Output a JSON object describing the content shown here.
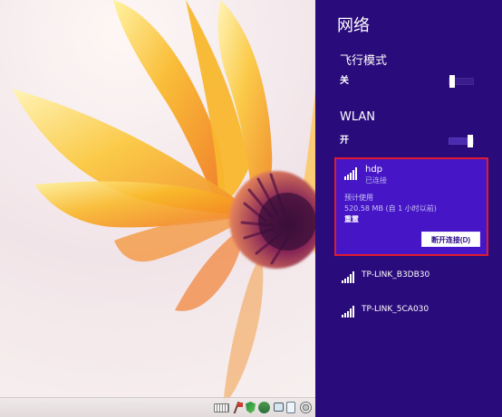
{
  "network_panel": {
    "title": "网络",
    "airplane_mode": {
      "label": "飞行模式",
      "state_label": "关",
      "enabled": false
    },
    "wlan": {
      "label": "WLAN",
      "state_label": "开",
      "enabled": true
    },
    "connected_network": {
      "name": "hdp",
      "status": "已连接",
      "usage_label": "预计使用",
      "usage_value": "520.58 MB (自 1 小时以前)",
      "reset_label": "重置",
      "disconnect_label": "断开连接(D)",
      "icon": "wifi-signal-icon"
    },
    "other_networks": [
      {
        "name": "TP-LINK_B3DB30",
        "icon": "wifi-signal-icon"
      },
      {
        "name": "TP-LINK_5CA030",
        "icon": "wifi-signal-icon"
      }
    ]
  },
  "taskbar": {
    "icons": [
      "keyboard-icon",
      "flag-icon",
      "security-shield-icon",
      "people-icon",
      "monitor-icon",
      "document-icon",
      "settings-icon"
    ]
  },
  "colors": {
    "panel_background": "#2a0b7b",
    "selected_network": "#4616c6",
    "highlight_border": "#e11b2d",
    "text_primary": "#ffffff",
    "text_secondary": "#c9c4f4"
  }
}
